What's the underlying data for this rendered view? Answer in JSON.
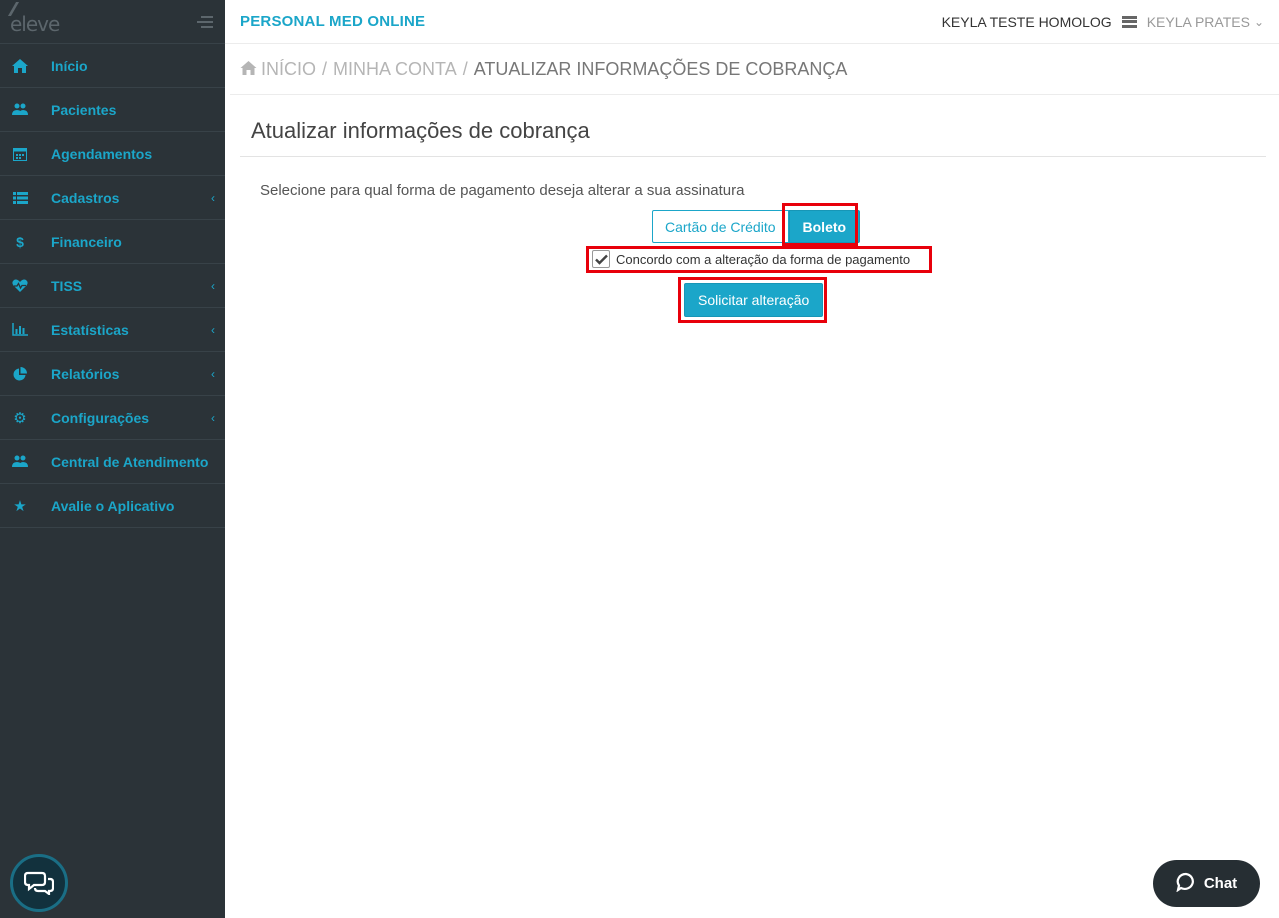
{
  "sidebar": {
    "logo_text": "eleve",
    "items": [
      {
        "label": "Início",
        "icon": "home-icon",
        "has_submenu": false
      },
      {
        "label": "Pacientes",
        "icon": "users-icon",
        "has_submenu": false
      },
      {
        "label": "Agendamentos",
        "icon": "calendar-icon",
        "has_submenu": false
      },
      {
        "label": "Cadastros",
        "icon": "list-icon",
        "has_submenu": true
      },
      {
        "label": "Financeiro",
        "icon": "dollar-icon",
        "has_submenu": false
      },
      {
        "label": "TISS",
        "icon": "heartbeat-icon",
        "has_submenu": true
      },
      {
        "label": "Estatísticas",
        "icon": "bar-chart-icon",
        "has_submenu": true
      },
      {
        "label": "Relatórios",
        "icon": "pie-chart-icon",
        "has_submenu": true
      },
      {
        "label": "Configurações",
        "icon": "gear-icon",
        "has_submenu": true
      },
      {
        "label": "Central de Atendimento",
        "icon": "users-icon",
        "has_submenu": false
      },
      {
        "label": "Avalie o Aplicativo",
        "icon": "star-icon",
        "has_submenu": false
      }
    ],
    "caret": "‹"
  },
  "header": {
    "app_title": "PERSONAL MED ONLINE",
    "clinic_name": "KEYLA TESTE HOMOLOG",
    "user_name": "KEYLA PRATES",
    "user_caret": "⌄"
  },
  "breadcrumb": {
    "items": [
      "INÍCIO",
      "MINHA CONTA"
    ],
    "separator": "/",
    "current": "ATUALIZAR INFORMAÇÕES DE COBRANÇA"
  },
  "main": {
    "title": "Atualizar informações de cobrança",
    "instruction": "Selecione para qual forma de pagamento deseja alterar a sua assinatura",
    "option_credit": "Cartão de Crédito",
    "option_boleto": "Boleto",
    "agree_label": "Concordo com a alteração da forma de pagamento",
    "agree_checked": true,
    "submit_label": "Solicitar alteração"
  },
  "chat": {
    "label": "Chat"
  },
  "colors": {
    "accent": "#1ba6c9",
    "sidebar_bg": "#2b3338",
    "highlight": "#e8000b"
  }
}
